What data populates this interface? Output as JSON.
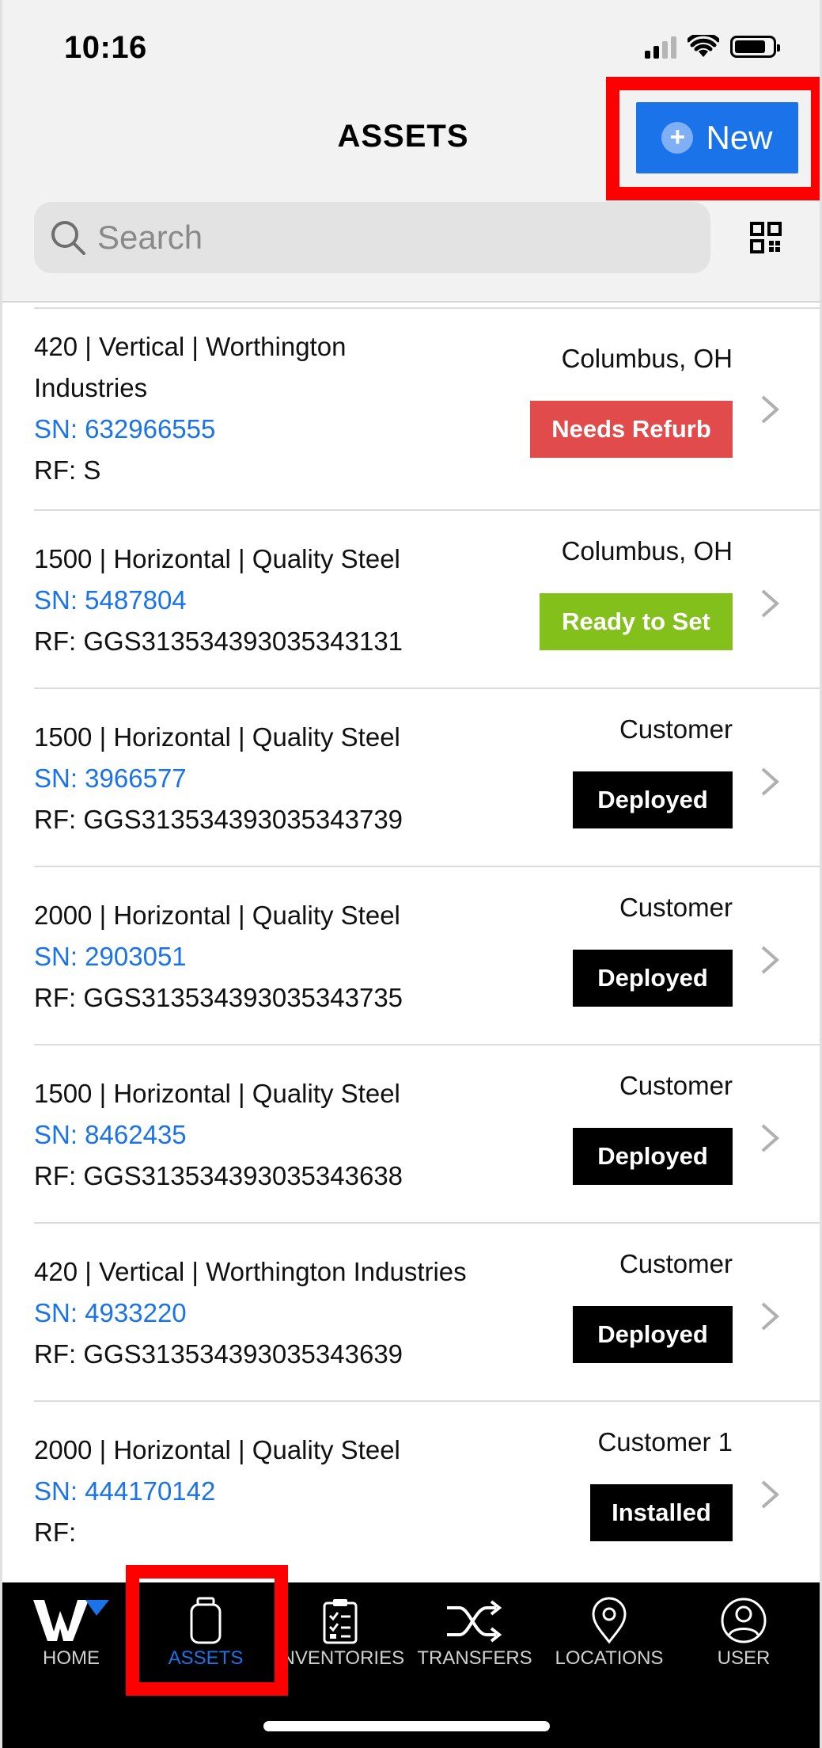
{
  "status_bar": {
    "time": "10:16"
  },
  "header": {
    "title": "ASSETS",
    "new_button_label": "New"
  },
  "search": {
    "placeholder": "Search"
  },
  "colors": {
    "accent": "#1a73e8",
    "needs_refurb": "#e14b4b",
    "ready_to_set": "#84c01b",
    "deployed": "#000000",
    "installed": "#000000",
    "highlight": "#ff0000"
  },
  "assets": [
    {
      "desc": "420 | Vertical | Worthington",
      "desc2": "Industries",
      "sn": "SN: 632966555",
      "rf": "RF: S",
      "location": "Columbus, OH",
      "status": "Needs Refurb"
    },
    {
      "desc": "1500 | Horizontal | Quality Steel",
      "sn": "SN: 5487804",
      "rf": "RF: GGS313534393035343131",
      "location": "Columbus, OH",
      "status": "Ready to Set"
    },
    {
      "desc": "1500 | Horizontal | Quality Steel",
      "sn": "SN: 3966577",
      "rf": "RF: GGS313534393035343739",
      "location": "Customer",
      "status": "Deployed"
    },
    {
      "desc": "2000 | Horizontal | Quality Steel",
      "sn": "SN: 2903051",
      "rf": "RF: GGS313534393035343735",
      "location": "Customer",
      "status": "Deployed"
    },
    {
      "desc": "1500 | Horizontal | Quality Steel",
      "sn": "SN: 8462435",
      "rf": "RF: GGS313534393035343638",
      "location": "Customer",
      "status": "Deployed"
    },
    {
      "desc": "420 | Vertical | Worthington Industries",
      "sn": "SN: 4933220",
      "rf": "RF: GGS313534393035343639",
      "location": "Customer",
      "status": "Deployed"
    },
    {
      "desc": "2000 | Horizontal | Quality Steel",
      "sn": "SN: 444170142",
      "rf": "RF:",
      "location": "Customer 1",
      "status": "Installed"
    }
  ],
  "tabs": [
    {
      "label": "HOME",
      "icon": "logo-w-icon"
    },
    {
      "label": "ASSETS",
      "icon": "tank-icon",
      "active": true
    },
    {
      "label": "INVENTORIES",
      "icon": "clipboard-icon"
    },
    {
      "label": "TRANSFERS",
      "icon": "shuffle-icon"
    },
    {
      "label": "LOCATIONS",
      "icon": "map-pin-icon"
    },
    {
      "label": "USER",
      "icon": "user-icon"
    }
  ]
}
